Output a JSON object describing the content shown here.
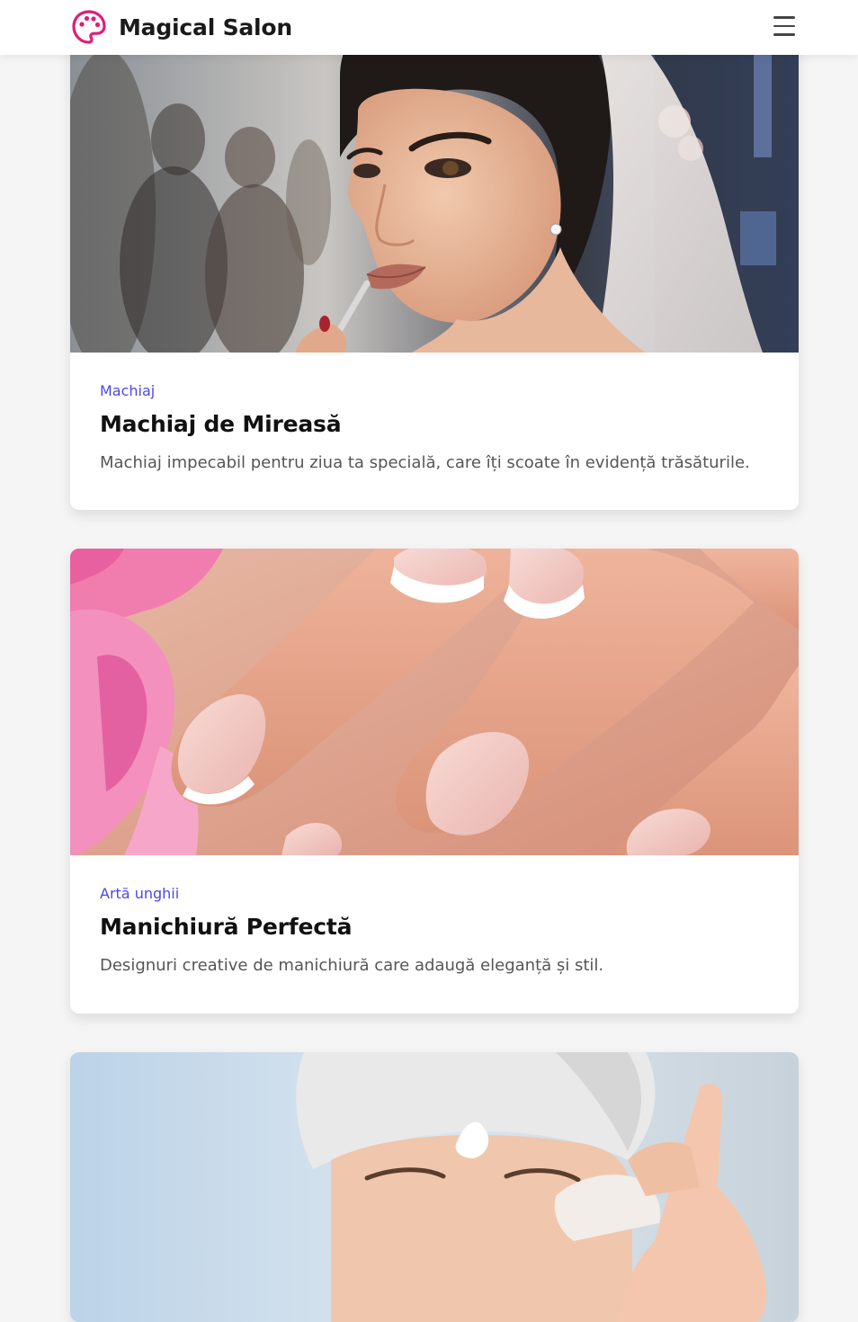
{
  "header": {
    "brand_name": "Magical Salon",
    "logo_icon": "palette-icon",
    "menu_icon": "hamburger-menu-icon",
    "brand_color": "#e11d74"
  },
  "cards": [
    {
      "category": "Machiaj",
      "title": "Machiaj de Mireasă",
      "description": "Machiaj impecabil pentru ziua ta specială, care îți scoate în evidență trăsăturile."
    },
    {
      "category": "Artă unghii",
      "title": "Manichiură Perfectă",
      "description": "Designuri creative de manichiură care adaugă eleganță și stil."
    },
    {
      "category": "",
      "title": "",
      "description": ""
    }
  ],
  "accent_color": "#4f46e5"
}
